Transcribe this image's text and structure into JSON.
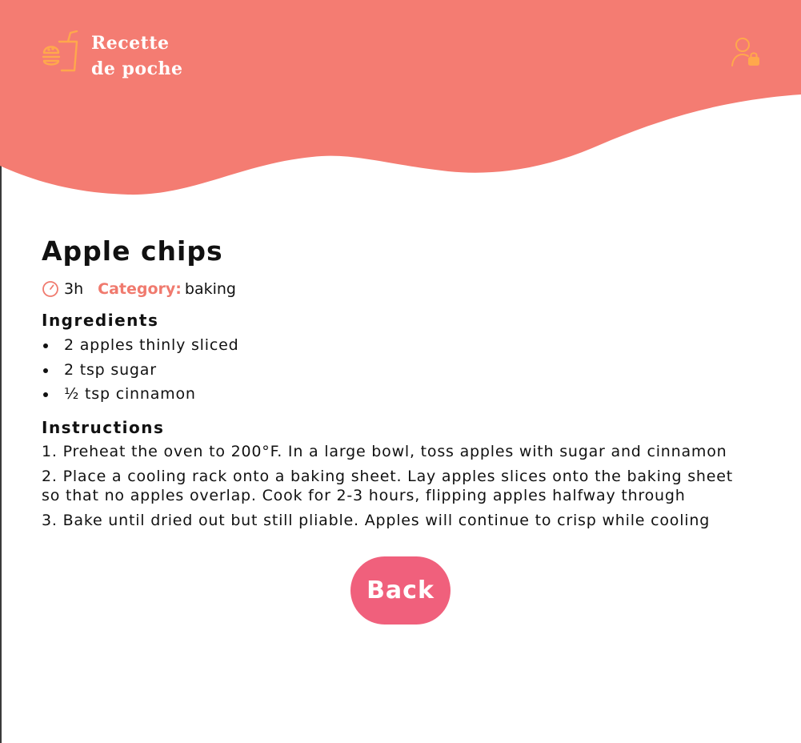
{
  "header": {
    "brand_line1": "Recette",
    "brand_line2": "de poche",
    "logo_icon": "food-tray-icon",
    "user_icon": "user-lock-icon"
  },
  "recipe": {
    "title": "Apple chips",
    "time": "3h",
    "category_label": "Category:",
    "category": "baking",
    "ingredients_heading": "Ingredients",
    "ingredients": [
      "2 apples thinly sliced",
      "2 tsp sugar",
      "½ tsp cinnamon"
    ],
    "instructions_heading": "Instructions",
    "instructions": [
      "1. Preheat the oven to 200°F. In a large bowl, toss apples with sugar and cinnamon",
      "2. Place a cooling rack onto a baking sheet. Lay apples slices onto the baking sheet so that no apples overlap. Cook for 2-3 hours, flipping apples halfway through",
      "3. Bake until dried out but still pliable. Apples will continue to crisp while cooling"
    ]
  },
  "actions": {
    "back_label": "Back"
  },
  "colors": {
    "header_bg": "#f47c72",
    "accent": "#f07a6e",
    "icon_orange": "#ffa84c",
    "button_bg": "#f0607c"
  }
}
